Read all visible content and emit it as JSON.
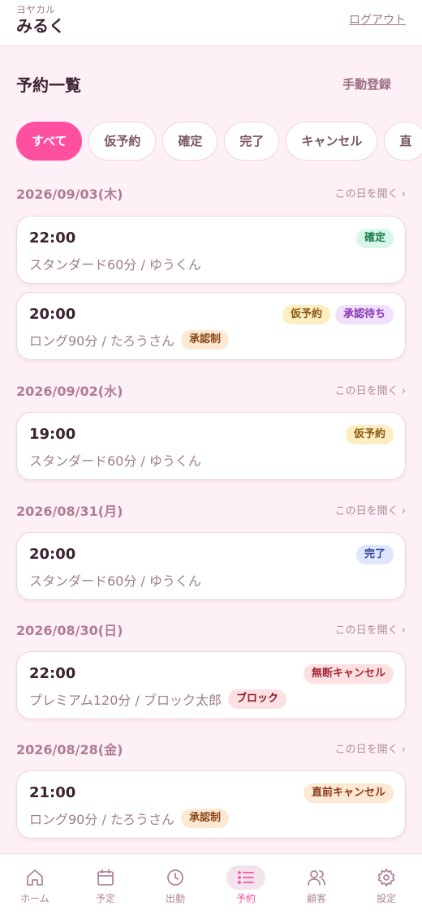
{
  "header": {
    "brand_sub": "ヨヤカル",
    "user_name": "みるく",
    "logout_label": "ログアウト"
  },
  "page": {
    "title": "予約一覧",
    "manual_button": "手動登録"
  },
  "filters": [
    "すべて",
    "仮予約",
    "確定",
    "完了",
    "キャンセル",
    "直"
  ],
  "open_day_label": "この日を開く ›",
  "dates": [
    "2026/09/03(木)",
    "2026/09/02(水)",
    "2026/08/31(月)",
    "2026/08/30(日)",
    "2026/08/28(金)"
  ],
  "cards": [
    {
      "time": "22:00",
      "desc": "スタンダード60分 / ゆうくん",
      "badges": [
        "確定"
      ],
      "tag": ""
    },
    {
      "time": "20:00",
      "desc": "ロング90分 / たろうさん",
      "badges": [
        "仮予約",
        "承認待ち"
      ],
      "tag": "承認制"
    },
    {
      "time": "19:00",
      "desc": "スタンダード60分 / ゆうくん",
      "badges": [
        "仮予約"
      ],
      "tag": ""
    },
    {
      "time": "20:00",
      "desc": "スタンダード60分 / ゆうくん",
      "badges": [
        "完了"
      ],
      "tag": ""
    },
    {
      "time": "22:00",
      "desc": "プレミアム120分 / ブロック太郎",
      "badges": [
        "無断キャンセル"
      ],
      "tag": "ブロック"
    },
    {
      "time": "21:00",
      "desc": "ロング90分 / たろうさん",
      "badges": [
        "直前キャンセル"
      ],
      "tag": "承認制"
    }
  ],
  "nav": [
    {
      "label": "ホーム",
      "icon": "home-icon"
    },
    {
      "label": "予定",
      "icon": "calendar-icon"
    },
    {
      "label": "出勤",
      "icon": "clock-icon"
    },
    {
      "label": "予約",
      "icon": "list-icon"
    },
    {
      "label": "顧客",
      "icon": "users-icon"
    },
    {
      "label": "設定",
      "icon": "gear-icon"
    }
  ],
  "colors": {
    "accent": "#ff4fa0",
    "background": "#fdf0f6",
    "card_border": "#f0d4df"
  }
}
